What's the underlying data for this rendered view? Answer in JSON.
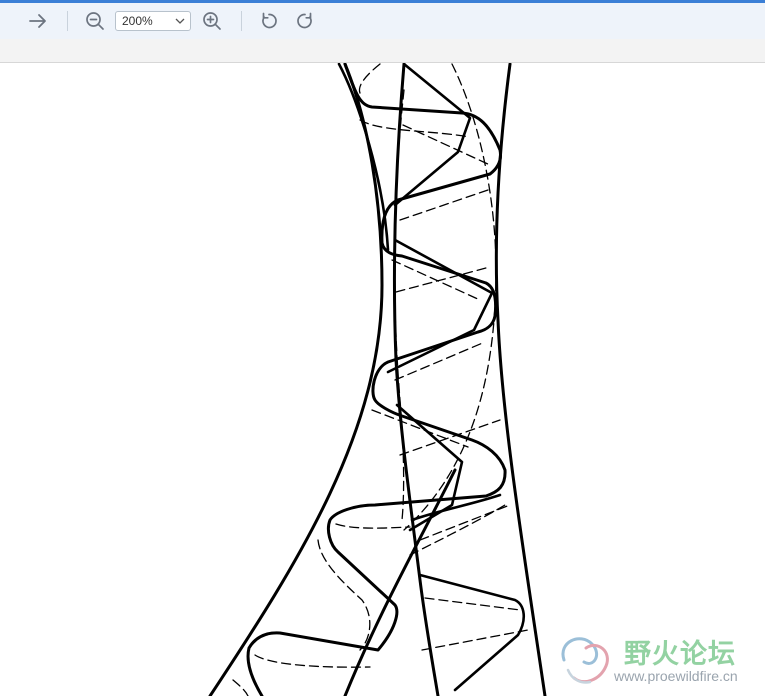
{
  "toolbar": {
    "icons": {
      "forward": "arrow-right-icon",
      "zoom_out": "zoom-out-icon",
      "zoom_in": "zoom-in-icon",
      "rotate_left": "rotate-counterclockwise-icon",
      "rotate_right": "rotate-clockwise-icon",
      "dropdown": "chevron-down-icon"
    },
    "zoom_value": "200%"
  },
  "watermark": {
    "title": "野火论坛",
    "url": "www.proewildfire.cn"
  },
  "colors": {
    "accent": "#3b7fd6",
    "toolbar_bg": "#eef3fa",
    "drawing_stroke": "#000000",
    "watermark_green": "#93d2a2"
  }
}
